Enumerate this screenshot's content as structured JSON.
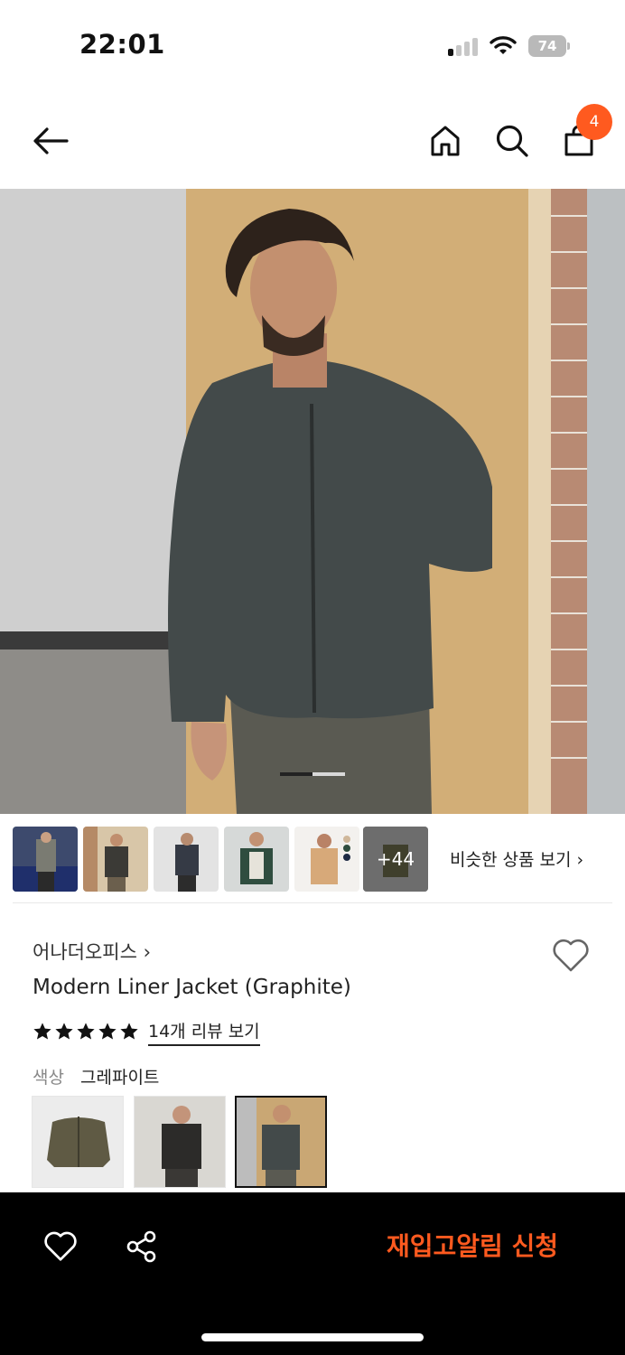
{
  "status_bar": {
    "time": "22:01",
    "battery": "74"
  },
  "nav": {
    "cart_count": "4",
    "icons": [
      "back-arrow-icon",
      "home-icon",
      "search-icon",
      "shopping-bag-icon"
    ]
  },
  "gallery": {
    "current_index": 2,
    "total_pages": 3,
    "more_count": "+44",
    "similar_label": "비슷한 상품 보기 ›"
  },
  "product": {
    "brand": "어나더오피스 ›",
    "name": "Modern Liner Jacket (Graphite)",
    "rating_stars": 5,
    "reviews_label": "14개 리뷰 보기",
    "color_label": "색상",
    "color_value": "그레파이트",
    "selected_swatch": 2
  },
  "bottom": {
    "restock_label": "재입고알림 신청"
  },
  "colors": {
    "accent": "#ff5a1f",
    "bar": "#000000",
    "text": "#222222",
    "muted": "#888888"
  }
}
